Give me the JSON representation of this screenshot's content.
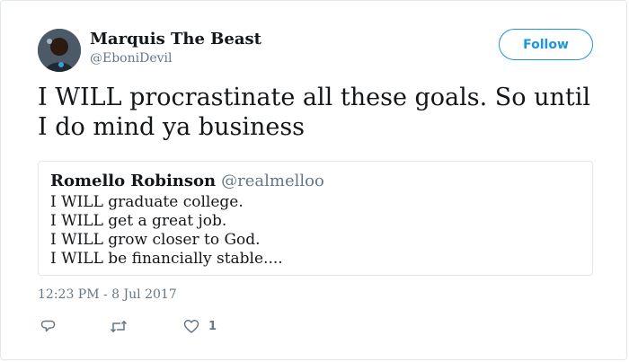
{
  "author": {
    "name": "Marquis The Beast",
    "handle": "@EboniDevil"
  },
  "follow_label": "Follow",
  "tweet_text": "I WILL procrastinate all these goals. So until I do mind ya business",
  "quoted_tweet": {
    "name": "Romello Robinson",
    "handle": "@realmelloo",
    "lines": [
      "I WILL graduate college.",
      "I WILL get a great job.",
      "I WILL grow closer to God.",
      "I WILL be financially stable...."
    ]
  },
  "timestamp": "12:23 PM - 8 Jul 2017",
  "actions": {
    "like_count": "1"
  },
  "colors": {
    "accent": "#1b95e0",
    "secondary_text": "#657786",
    "border": "#e1e8ed"
  },
  "icons": {
    "reply": "reply-icon",
    "retweet": "retweet-icon",
    "like": "heart-icon"
  }
}
